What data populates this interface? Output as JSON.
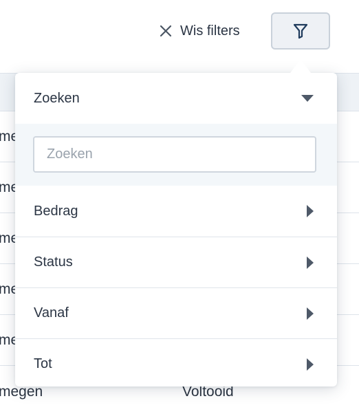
{
  "toolbar": {
    "clear_filters_label": "Wis filters",
    "clear_icon": "close-icon",
    "filter_icon": "funnel-icon",
    "accent_color": "#1f3b5c"
  },
  "filter_panel": {
    "search_section": {
      "label": "Zoeken",
      "placeholder": "Zoeken",
      "value": "",
      "expanded": true
    },
    "items": [
      {
        "label": "Bedrag",
        "icon": "chevron-right-icon"
      },
      {
        "label": "Status",
        "icon": "chevron-right-icon"
      },
      {
        "label": "Vanaf",
        "icon": "chevron-right-icon"
      },
      {
        "label": "Tot",
        "icon": "chevron-right-icon"
      }
    ]
  },
  "background_table": {
    "rows": [
      {
        "col1": "me",
        "col2": ""
      },
      {
        "col1": "me",
        "col2": ""
      },
      {
        "col1": "me",
        "col2": ""
      },
      {
        "col1": "me",
        "col2": ""
      },
      {
        "col1": "me",
        "col2": ""
      },
      {
        "col1": "megen",
        "col2": "Voltooid"
      }
    ]
  }
}
